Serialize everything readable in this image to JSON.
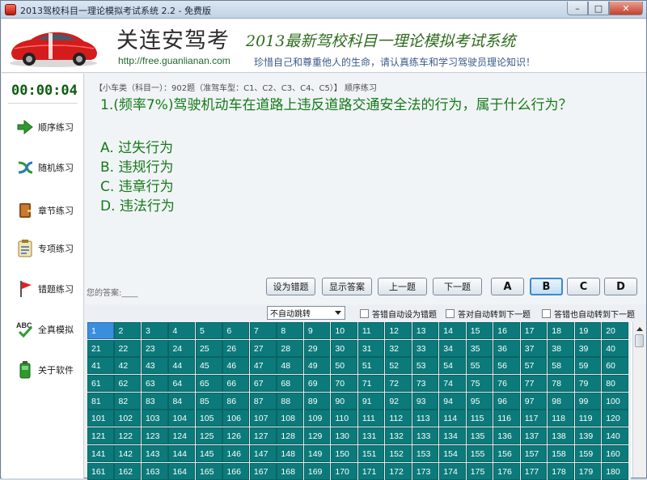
{
  "window": {
    "title": "2013驾校科目一理论模拟考试系统 2.2 - 免费版",
    "controls": {
      "minimize": "–",
      "maximize": "□",
      "close": "✕"
    }
  },
  "header": {
    "brand_name": "关连安驾考",
    "brand_url": "http://free.guanlianan.com",
    "slogan": "2013最新驾校科目一理论模拟考试系统",
    "subtitle": "珍惜自己和尊重他人的生命，请认真练车和学习驾驶员理论知识！"
  },
  "sidebar": {
    "timer": "00:00:04",
    "items": [
      {
        "label": "顺序练习",
        "icon": "arrow-right-icon"
      },
      {
        "label": "随机练习",
        "icon": "shuffle-icon"
      },
      {
        "label": "章节练习",
        "icon": "book-icon"
      },
      {
        "label": "专项练习",
        "icon": "checklist-icon"
      },
      {
        "label": "错题练习",
        "icon": "flag-icon"
      },
      {
        "label": "全真模拟",
        "icon": "abc-check-icon"
      },
      {
        "label": "关于软件",
        "icon": "battery-icon"
      }
    ]
  },
  "question": {
    "header": "【小车类（科目一）：902题（准驾车型：C1、C2、C3、C4、C5）】 顺序练习",
    "text": "1.(频率7%)驾驶机动车在道路上违反道路交通安全法的行为，属于什么行为？",
    "options": [
      "A. 过失行为",
      "B. 违规行为",
      "C. 违章行为",
      "D. 违法行为"
    ]
  },
  "answer": {
    "label": "您的答案:____"
  },
  "actions": {
    "set_wrong": "设为错题",
    "show_answer": "显示答案",
    "prev": "上一题",
    "next": "下一题"
  },
  "answer_buttons": [
    {
      "label": "A",
      "selected": false
    },
    {
      "label": "B",
      "selected": true
    },
    {
      "label": "C",
      "selected": false
    },
    {
      "label": "D",
      "selected": false
    }
  ],
  "controls": {
    "jump_select_value": "不自动跳转",
    "checkboxes": [
      {
        "label": "答错自动设为错题",
        "checked": false
      },
      {
        "label": "答对自动转到下一题",
        "checked": false
      },
      {
        "label": "答错也自动转到下一题",
        "checked": false
      }
    ]
  },
  "grid": {
    "first": 1,
    "last": 180,
    "current": 1,
    "colors": {
      "cell": "#0c7a7a",
      "current": "#3a8ede"
    }
  }
}
